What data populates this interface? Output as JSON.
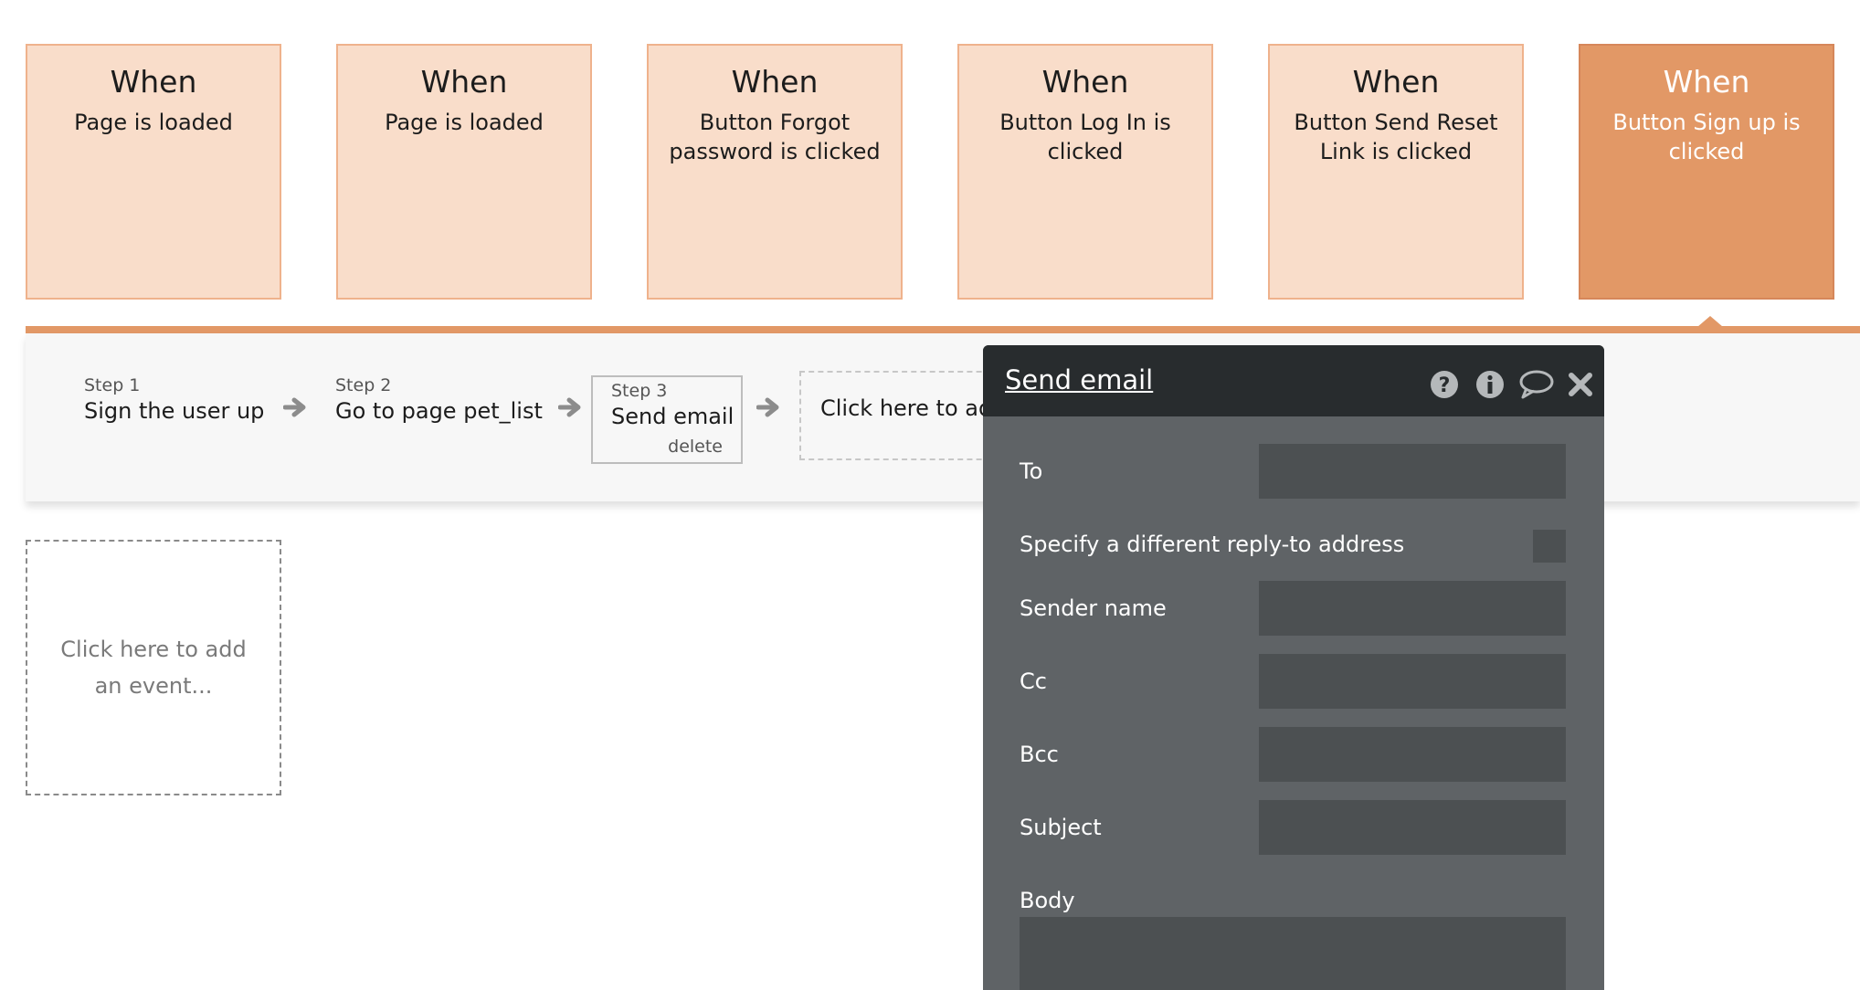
{
  "events": [
    {
      "when": "When",
      "desc": "Page is loaded"
    },
    {
      "when": "When",
      "desc": "Page is loaded"
    },
    {
      "when": "When",
      "desc": "Button Forgot password is clicked"
    },
    {
      "when": "When",
      "desc": "Button Log In is clicked"
    },
    {
      "when": "When",
      "desc": "Button Send Reset Link is clicked"
    },
    {
      "when": "When",
      "desc": "Button Sign up is clicked",
      "selected": true
    }
  ],
  "steps": [
    {
      "num": "Step 1",
      "name": "Sign the user up"
    },
    {
      "num": "Step 2",
      "name": "Go to page pet_list"
    },
    {
      "num": "Step 3",
      "name": "Send email",
      "delete_label": "delete"
    }
  ],
  "add_action_label": "Click here to add an action...",
  "add_event_label": "Click here to add an event...",
  "editor": {
    "title": "Send email",
    "icons": [
      "help-icon",
      "info-icon",
      "comment-icon",
      "close-icon"
    ],
    "fields": {
      "to": {
        "label": "To",
        "value": ""
      },
      "reply_to": {
        "label": "Specify a different reply-to address",
        "checked": false
      },
      "sender_name": {
        "label": "Sender name",
        "value": ""
      },
      "cc": {
        "label": "Cc",
        "value": ""
      },
      "bcc": {
        "label": "Bcc",
        "value": ""
      },
      "subject": {
        "label": "Subject",
        "value": ""
      },
      "body": {
        "label": "Body",
        "value": ""
      }
    }
  },
  "colors": {
    "event_card": "#f9ddca",
    "event_card_border": "#efb28c",
    "event_selected": "#e29866",
    "panel_bg": "#f7f7f7",
    "editor_bg": "#5f6366",
    "editor_header": "#282c2e",
    "editor_input": "#4c5052"
  }
}
